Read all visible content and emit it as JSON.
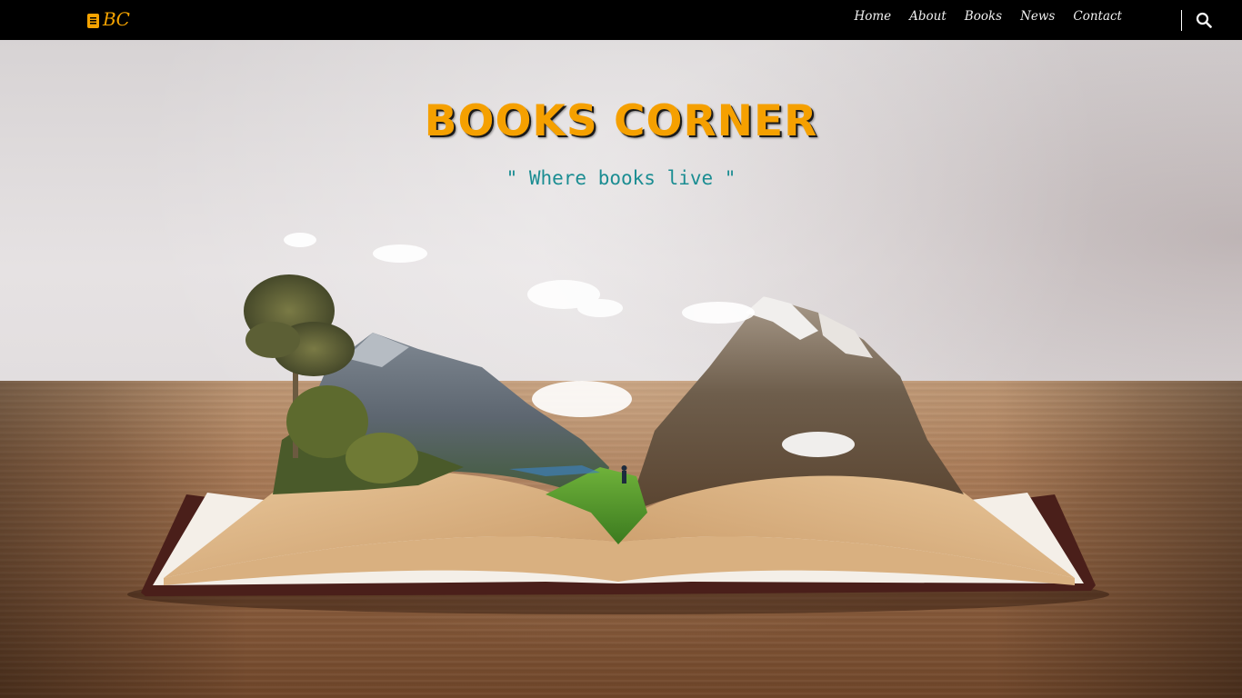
{
  "navbar": {
    "brand": {
      "text": "BC",
      "icon": "book-icon",
      "color": "#f5a300"
    },
    "links": [
      "Home",
      "About",
      "Books",
      "News",
      "Contact"
    ],
    "search_icon": "search-icon"
  },
  "hero": {
    "title": "BOOKS CORNER",
    "tagline": "\" Where books live \"",
    "title_color": "#f5a000",
    "tagline_color": "#1b8d92"
  }
}
